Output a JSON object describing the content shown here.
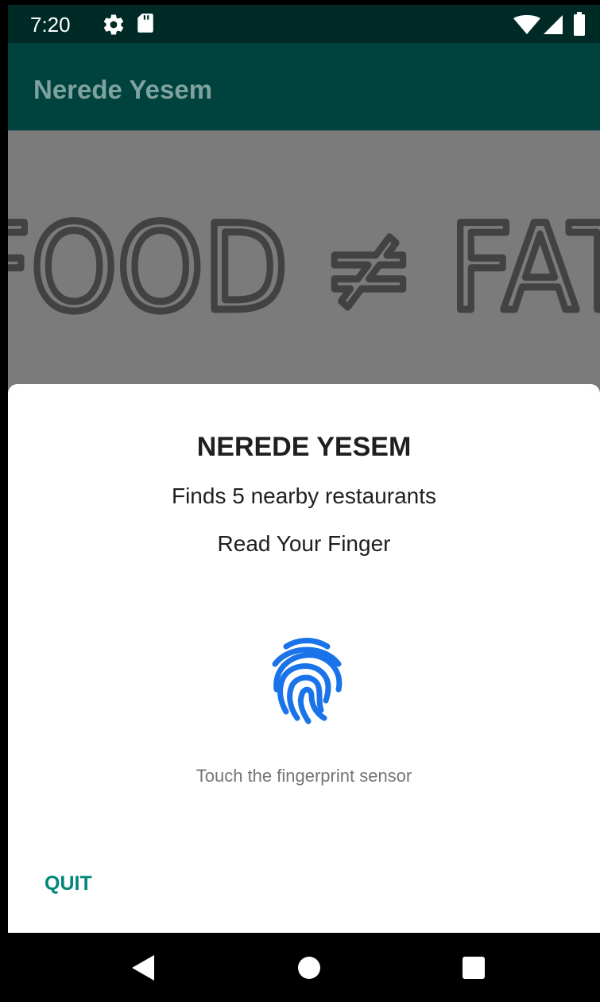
{
  "status_bar": {
    "time": "7:20",
    "icons": [
      "gear-icon",
      "sd-card-icon",
      "wifi-icon",
      "signal-icon",
      "battery-icon"
    ]
  },
  "app_bar": {
    "title": "Nerede Yesem"
  },
  "banner": {
    "text": "FOOD ≠ FAT"
  },
  "dialog": {
    "title": "NEREDE YESEM",
    "subtitle": "Finds 5 nearby restaurants",
    "description": "Read Your Finger",
    "icon": "fingerprint-icon",
    "hint": "Touch the fingerprint sensor",
    "quit_label": "QUIT"
  },
  "nav_bar": {
    "icons": [
      "back-icon",
      "home-icon",
      "recents-icon"
    ]
  },
  "colors": {
    "status_bar": "#002a26",
    "app_bar": "#00423d",
    "accent": "#00877a",
    "fingerprint": "#1a73e8"
  }
}
